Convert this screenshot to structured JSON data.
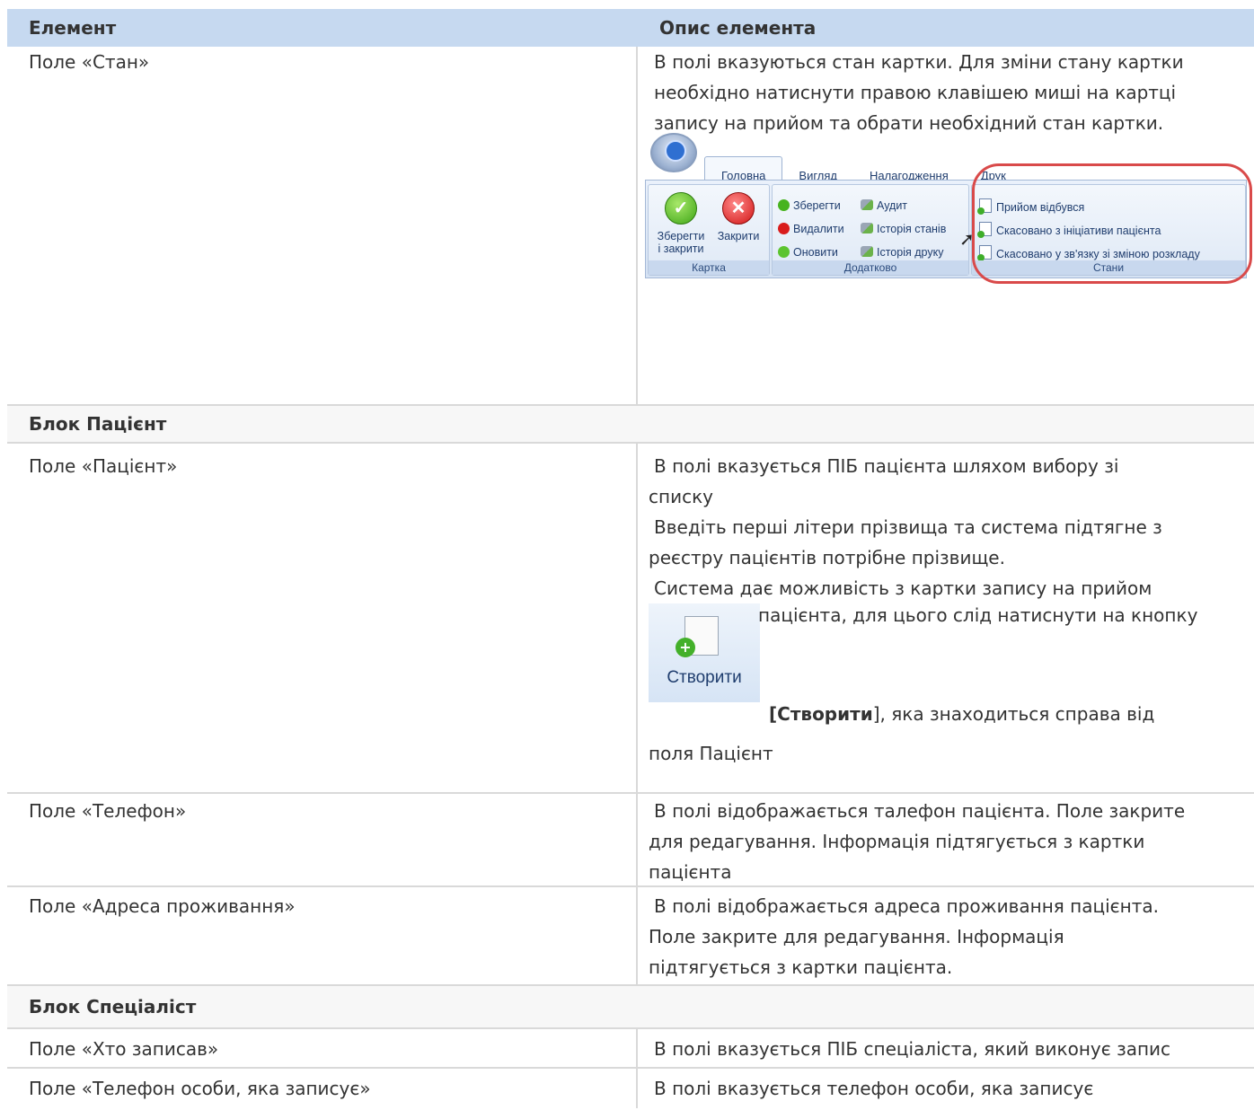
{
  "table": {
    "header": {
      "col1": "Елемент",
      "col2": "Опис елемента"
    },
    "row_stan": {
      "name": "Поле «Стан»",
      "lines": [
        "В полі вказуються стан картки. Для зміни стану картки",
        "необхідно натиснути правою клавішею миші на картці",
        "запису на прийом та обрати необхідний стан картки."
      ]
    },
    "ribbon": {
      "tabs": [
        "Головна",
        "Вигляд",
        "Налагодження",
        "Друк"
      ],
      "save_close": [
        "Зберегти",
        "і закрити"
      ],
      "close": "Закрити",
      "group_card": "Картка",
      "save": "Зберегти",
      "delete": "Видалити",
      "refresh": "Оновити",
      "audit": "Аудит",
      "state_history": "Історія станів",
      "print_history": "Історія друку",
      "group_extra": "Додатково",
      "state1": "Прийом відбувся",
      "state2": "Скасовано з ініціативи пацієнта",
      "state3": "Скасовано у зв'язку зі зміною розкладу",
      "group_states": "Стани"
    },
    "section_patient": "Блок Пацієнт",
    "row_patient": {
      "name": "Поле «Пацієнт»",
      "line1": "В полі вказується ПІБ пацієнта шляхом вибору зі",
      "line2": "списку",
      "line3": "Введіть перші літери прізвища та система підтягне з",
      "line4": "реєстру пацієнтів потрібне прізвище.",
      "line5": "Система дає можливість з картки запису на прийом",
      "line6": "пацієнта, для цього слід натиснути на кнопку",
      "btn_label": "Створити",
      "line7_bold": "[Створити",
      "line7_rest": "], яка знаходиться справа від",
      "line8": "поля Пацієнт"
    },
    "row_phone": {
      "name": "Поле «Телефон»",
      "lines": [
        "В полі відображається талефон пацієнта. Поле закрите",
        "для редагування. Інформація підтягується з картки",
        "пацієнта"
      ]
    },
    "row_address": {
      "name": "Поле «Адреса проживання»",
      "lines": [
        "В полі відображається адреса проживання пацієнта.",
        "Поле закрите для редагування. Інформація",
        "підтягується з картки пацієнта."
      ]
    },
    "section_specialist": "Блок Спеціаліст",
    "row_who": {
      "name": "Поле «Хто записав»",
      "line": "В полі вказується ПІБ спеціаліста, який виконує запис"
    },
    "row_phone_person": {
      "name": "Поле «Телефон особи, яка записує»",
      "line": "В полі вказується телефон особи, яка записує"
    }
  }
}
